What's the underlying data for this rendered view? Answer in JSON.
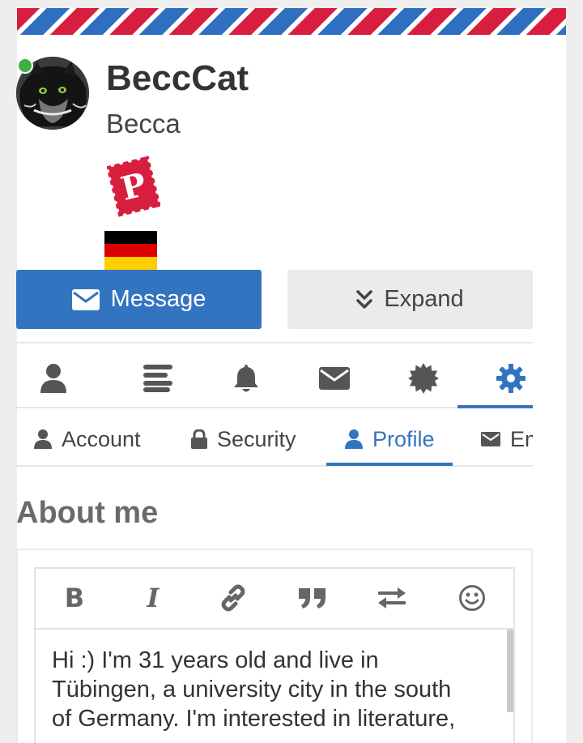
{
  "profile": {
    "username": "BeccCat",
    "real_name": "Becca",
    "badge_letter": "P",
    "online": true
  },
  "actions": {
    "message_label": "Message",
    "expand_label": "Expand"
  },
  "icon_tabs": [
    {
      "name": "profile",
      "icon": "user-icon"
    },
    {
      "name": "feed",
      "icon": "list-icon"
    },
    {
      "name": "notifications",
      "icon": "bell-icon"
    },
    {
      "name": "messages",
      "icon": "envelope-icon"
    },
    {
      "name": "badges",
      "icon": "certificate-icon"
    },
    {
      "name": "settings",
      "icon": "gear-icon",
      "active": true
    }
  ],
  "text_tabs": [
    {
      "label": "Account",
      "icon": "user-icon"
    },
    {
      "label": "Security",
      "icon": "lock-icon"
    },
    {
      "label": "Profile",
      "icon": "user-icon",
      "active": true
    },
    {
      "label": "Em",
      "icon": "envelope-icon"
    }
  ],
  "about": {
    "title": "About me",
    "text_lines": [
      "Hi :) I'm 31 years old and live in",
      "Tübingen, a university city in the south",
      "of Germany. I'm interested in literature,"
    ]
  },
  "editor_tools": [
    "bold-icon",
    "italic-icon",
    "link-icon",
    "quote-icon",
    "exchange-icon",
    "smiley-icon"
  ],
  "colors": {
    "accent": "#3374c1",
    "online": "#3cb043",
    "stamp": "#d81e3f",
    "airmail_red": "#d81e3f",
    "airmail_blue": "#2f6fbf"
  }
}
